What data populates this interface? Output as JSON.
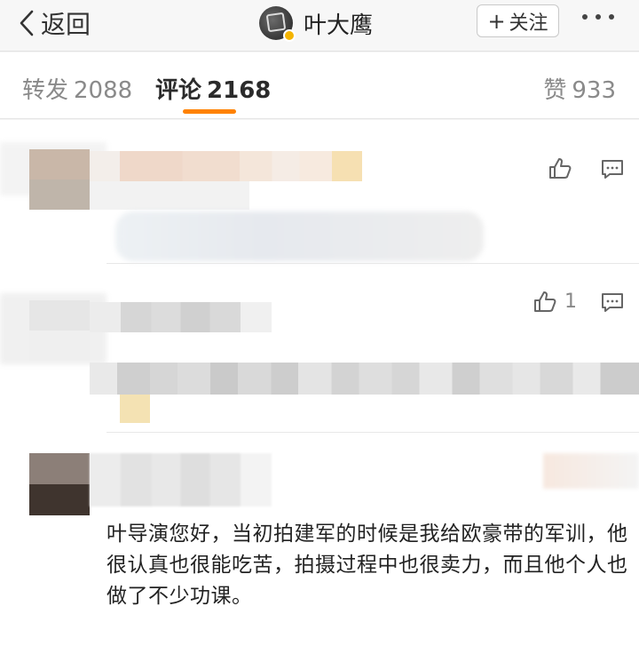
{
  "nav": {
    "back_label": "返回",
    "username": "叶大鹰",
    "follow_label": "关注",
    "follow_icon": "plus-icon",
    "more_icon": "more-dots-icon"
  },
  "tabs": {
    "repost_label": "转发",
    "repost_count": "2088",
    "comment_label": "评论",
    "comment_count": "2168",
    "like_label": "赞",
    "like_count": "933",
    "active": "comment",
    "accent_color": "#ff8200"
  },
  "comments": [
    {
      "like_count": "",
      "like_icon": "thumbs-up-icon",
      "reply_icon": "comment-icon"
    },
    {
      "like_count": "1",
      "like_icon": "thumbs-up-icon",
      "reply_icon": "comment-icon"
    },
    {
      "text": "叶导演您好，当初拍建军的时候是我给欧豪带的军训，他很认真也很能吃苦，拍摄过程中也很卖力，而且他个人也做了不少功课。"
    }
  ]
}
